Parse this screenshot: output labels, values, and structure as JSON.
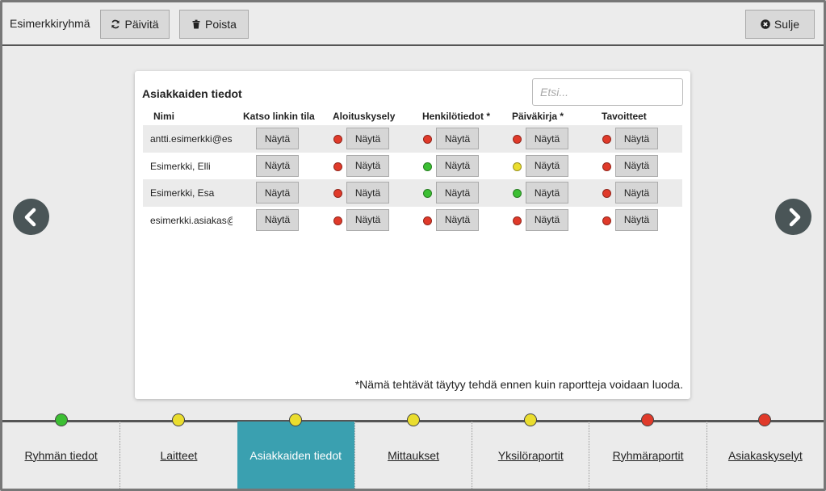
{
  "header": {
    "group_name": "Esimerkkiryhmä",
    "refresh_label": "Päivitä",
    "delete_label": "Poista",
    "close_label": "Sulje"
  },
  "colors": {
    "red": "#e03a2a",
    "green": "#3cbf33",
    "yellow": "#eadd2e",
    "accent": "#3aa0b0"
  },
  "panel": {
    "title": "Asiakkaiden tiedot",
    "search_placeholder": "Etsi...",
    "columns": [
      "Nimi",
      "Katso linkin tila",
      "Aloituskysely",
      "Henkilötiedot *",
      "Päiväkirja *",
      "Tavoitteet"
    ],
    "button_label": "Näytä",
    "rows": [
      {
        "name": "antti.esimerkki@esimerkki.fi",
        "statuses": [
          "red",
          "red",
          "red",
          "red"
        ]
      },
      {
        "name": "Esimerkki, Elli",
        "statuses": [
          "red",
          "green",
          "yellow",
          "red"
        ]
      },
      {
        "name": "Esimerkki, Esa",
        "statuses": [
          "red",
          "green",
          "green",
          "red"
        ]
      },
      {
        "name": "esimerkki.asiakas@esimerkki.fi",
        "statuses": [
          "red",
          "red",
          "red",
          "red"
        ]
      }
    ],
    "footnote": "*Nämä tehtävät täytyy tehdä ennen kuin raportteja voidaan luoda."
  },
  "navigation": {
    "prev": "chevron-left-icon",
    "next": "chevron-right-icon"
  },
  "steps": [
    {
      "label": "Ryhmän tiedot",
      "status": "green",
      "active": false
    },
    {
      "label": "Laitteet",
      "status": "yellow",
      "active": false
    },
    {
      "label": "Asiakkaiden tiedot",
      "status": "yellow",
      "active": true
    },
    {
      "label": "Mittaukset",
      "status": "yellow",
      "active": false
    },
    {
      "label": "Yksilöraportit",
      "status": "yellow",
      "active": false
    },
    {
      "label": "Ryhmäraportit",
      "status": "red",
      "active": false
    },
    {
      "label": "Asiakaskyselyt",
      "status": "red",
      "active": false
    }
  ]
}
